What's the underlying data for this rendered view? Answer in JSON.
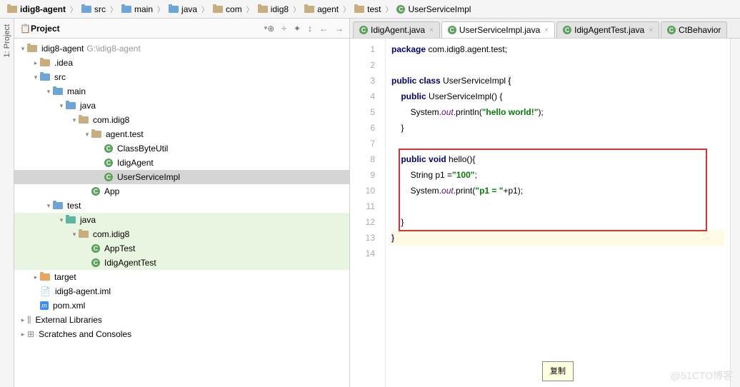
{
  "breadcrumb": [
    {
      "icon": "folder",
      "label": "idig8-agent",
      "bold": true
    },
    {
      "icon": "folder-blue",
      "label": "src"
    },
    {
      "icon": "folder-blue",
      "label": "main"
    },
    {
      "icon": "folder-blue",
      "label": "java"
    },
    {
      "icon": "folder",
      "label": "com"
    },
    {
      "icon": "folder",
      "label": "idig8"
    },
    {
      "icon": "folder",
      "label": "agent"
    },
    {
      "icon": "folder",
      "label": "test"
    },
    {
      "icon": "class",
      "label": "UserServiceImpl"
    }
  ],
  "sidebar_label": "1: Project",
  "project_header": {
    "title": "Project",
    "tool_icons": [
      "⊕",
      "÷",
      "✦",
      "↕",
      "←",
      "→"
    ]
  },
  "tree": [
    {
      "depth": 0,
      "arrow": "▾",
      "icon": "folder",
      "label": "idig8-agent",
      "muted": "G:\\idig8-agent"
    },
    {
      "depth": 1,
      "arrow": "▸",
      "icon": "folder",
      "label": ".idea"
    },
    {
      "depth": 1,
      "arrow": "▾",
      "icon": "folder-blue",
      "label": "src"
    },
    {
      "depth": 2,
      "arrow": "▾",
      "icon": "folder-blue",
      "label": "main"
    },
    {
      "depth": 3,
      "arrow": "▾",
      "icon": "folder-blue",
      "label": "java"
    },
    {
      "depth": 4,
      "arrow": "▾",
      "icon": "folder",
      "label": "com.idig8"
    },
    {
      "depth": 5,
      "arrow": "▾",
      "icon": "folder",
      "label": "agent.test"
    },
    {
      "depth": 6,
      "arrow": " ",
      "icon": "class",
      "label": "ClassByteUtil"
    },
    {
      "depth": 6,
      "arrow": " ",
      "icon": "class",
      "label": "IdigAgent"
    },
    {
      "depth": 6,
      "arrow": " ",
      "icon": "class",
      "label": "UserServiceImpl",
      "selected": true
    },
    {
      "depth": 5,
      "arrow": " ",
      "icon": "class",
      "label": "App"
    },
    {
      "depth": 2,
      "arrow": "▾",
      "icon": "folder-blue",
      "label": "test"
    },
    {
      "depth": 3,
      "arrow": "▾",
      "icon": "folder-teal",
      "label": "java",
      "test": true
    },
    {
      "depth": 4,
      "arrow": "▾",
      "icon": "folder",
      "label": "com.idig8",
      "test": true
    },
    {
      "depth": 5,
      "arrow": " ",
      "icon": "class",
      "label": "AppTest",
      "test": true
    },
    {
      "depth": 5,
      "arrow": " ",
      "icon": "class",
      "label": "IdigAgentTest",
      "test": true
    },
    {
      "depth": 1,
      "arrow": "▸",
      "icon": "folder-orange",
      "label": "target"
    },
    {
      "depth": 1,
      "arrow": " ",
      "icon": "file",
      "label": "idig8-agent.iml"
    },
    {
      "depth": 1,
      "arrow": " ",
      "icon": "maven",
      "label": "pom.xml"
    },
    {
      "depth": 0,
      "arrow": "▸",
      "icon": "lib",
      "label": "External Libraries"
    },
    {
      "depth": 0,
      "arrow": "▸",
      "icon": "scratch",
      "label": "Scratches and Consoles"
    }
  ],
  "tabs": [
    {
      "label": "IdigAgent.java",
      "active": false
    },
    {
      "label": "UserServiceImpl.java",
      "active": true
    },
    {
      "label": "IdigAgentTest.java",
      "active": false
    },
    {
      "label": "CtBehavior",
      "active": false,
      "truncated": true
    }
  ],
  "code": {
    "lines": [
      1,
      2,
      3,
      4,
      5,
      6,
      7,
      8,
      9,
      10,
      11,
      12,
      13,
      14
    ],
    "package_kw": "package",
    "package_name": " com.idig8.agent.test;",
    "public": "public",
    "class": "class",
    "void": "void",
    "cls": " UserServiceImpl ",
    "brace_open": "{",
    "ctor": " UserServiceImpl() {",
    "sys": "System.",
    "out": "out",
    "println": ".println(",
    "print": ".print(",
    "hello_str": "\"hello world!\"",
    "close_paren": ");",
    "brace_close": "}",
    "method": " hello(){",
    "p1_decl": "String p1 =",
    "p1_val": "\"100\"",
    "concat": "\"p1 = \"",
    "plus": "+p1);",
    "semicolon": ";"
  },
  "tooltip": "复制",
  "watermark": "@51CTO博客"
}
